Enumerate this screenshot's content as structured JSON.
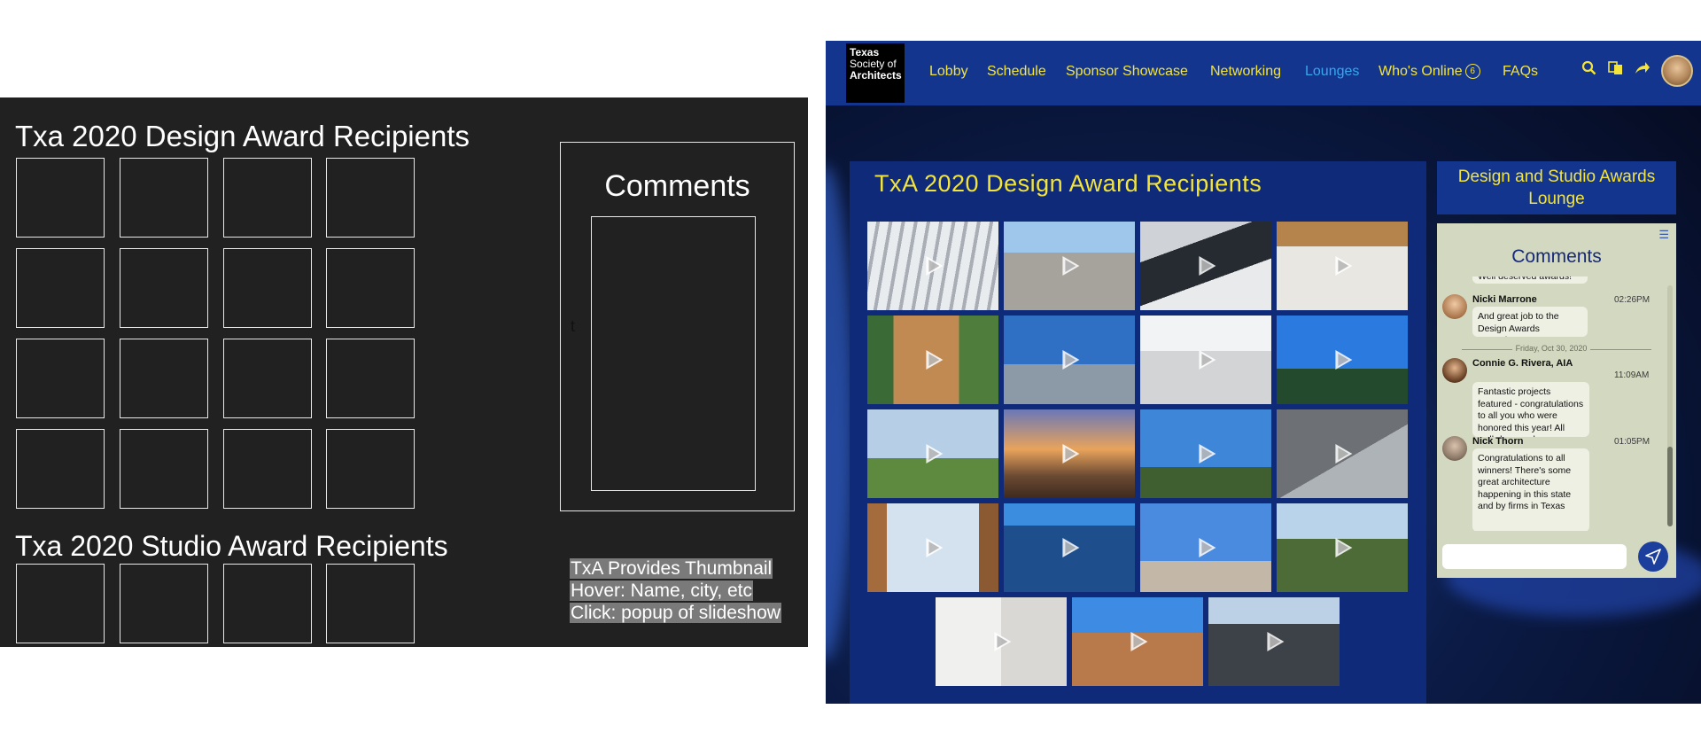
{
  "wireframe": {
    "design_title": "Txa 2020 Design Award Recipients",
    "studio_title": "Txa 2020 Studio Award Recipients",
    "comments_title": "Comments",
    "cursor_text": "t",
    "note_lines": [
      "TxA Provides Thumbnail",
      "Hover: Name, city, etc",
      "Click: popup of slideshow"
    ]
  },
  "mockup": {
    "logo": {
      "line1": "Texas",
      "line2": "Society of",
      "line3": "Architects"
    },
    "nav": {
      "lobby": "Lobby",
      "schedule": "Schedule",
      "sponsor": "Sponsor Showcase",
      "networking": "Networking",
      "lounges": "Lounges",
      "whos_online": "Who's Online",
      "online_count": "6",
      "faqs": "FAQs"
    },
    "panel_title": "TxA 2020 Design Award Recipients",
    "lounge_title": "Design and Studio Awards Lounge",
    "chat": {
      "title": "Comments",
      "partial_top": "Well deserved awards!",
      "messages": [
        {
          "name": "Nicki Marrone",
          "time": "02:26PM",
          "text": "And great job to the Design Awards Committee!"
        },
        {
          "name": "Connie G. Rivera, AIA",
          "time": "11:09AM",
          "text": "Fantastic projects featured - congratulations to all you who were honored this year! All well-deserved."
        },
        {
          "name": "Nick Thorn",
          "time": "01:05PM",
          "text": "Congratulations to all winners! There's some great architecture happening in this state and by firms in Texas"
        }
      ],
      "date_divider": "Friday, Oct 30, 2020",
      "input_placeholder": ""
    }
  },
  "colors": {
    "wire_bg": "#212121",
    "nav_bg": "#14358e",
    "nav_text": "#f3e43c",
    "nav_active": "#35a8f0",
    "panel_bg": "#0e2a78",
    "chat_bg": "#d3d9c0"
  }
}
